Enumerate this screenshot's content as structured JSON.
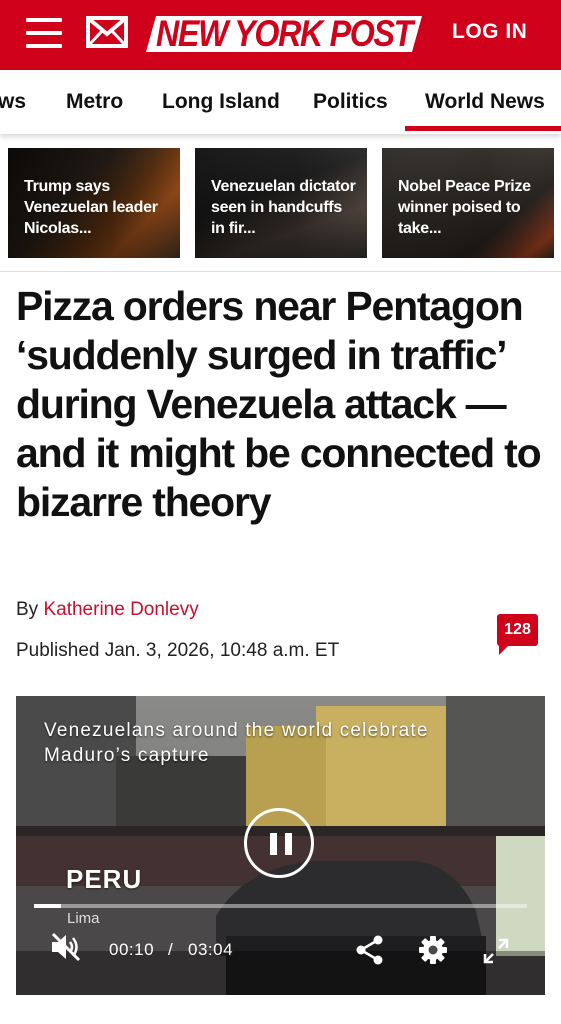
{
  "header": {
    "logo_text": "NEW YORK POST",
    "login_label": "LOG IN",
    "brand_color": "#d0021b",
    "icons": [
      "menu-icon",
      "mail-icon"
    ]
  },
  "nav": {
    "items": [
      "ws",
      "Metro",
      "Long Island",
      "Politics",
      "World News"
    ],
    "active": "World News"
  },
  "cards": [
    {
      "title": "Trump says Venezuelan leader Nicolas..."
    },
    {
      "title": "Venezuelan dictator seen in handcuffs in fir..."
    },
    {
      "title": "Nobel Peace Prize winner poised to take..."
    }
  ],
  "article": {
    "headline": "Pizza orders near Pentagon ‘suddenly surged in traffic’ during Venezuela attack — and it might be connected to bizarre theory",
    "by_label": "By",
    "author": "Katherine Donlevy",
    "published": "Published Jan. 3, 2026, 10:48 a.m. ET",
    "comment_count": "128"
  },
  "video": {
    "title": "Venezuelans around the world celebrate Maduro’s capture",
    "overlay_country": "PERU",
    "overlay_city": "Lima",
    "current_time": "00:10",
    "separator": "/",
    "duration": "03:04",
    "progress": 0.054,
    "state": "playing",
    "icons": [
      "pause-icon",
      "mute-icon",
      "share-icon",
      "settings-icon",
      "fullscreen-icon"
    ]
  }
}
